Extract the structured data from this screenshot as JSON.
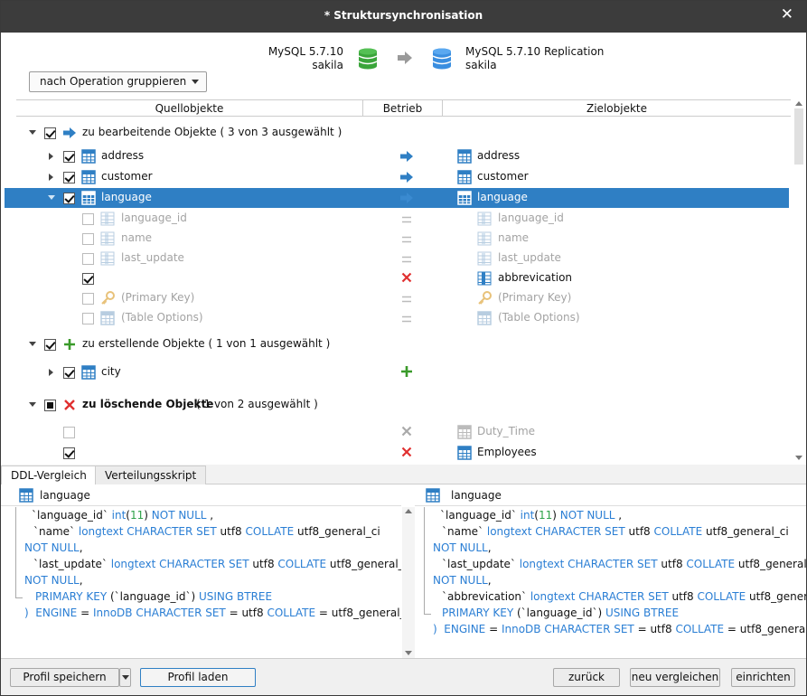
{
  "window": {
    "title": "* Struktursynchronisation",
    "close_glyph": "✕"
  },
  "connection": {
    "source": {
      "server": "MySQL 5.7.10",
      "schema": "sakila",
      "color": "#3aa53a"
    },
    "target": {
      "server": "MySQL 5.7.10 Replication",
      "schema": "sakila",
      "color": "#3a8ee0"
    }
  },
  "group_select": {
    "value": "nach Operation gruppieren"
  },
  "columns": {
    "source": "Quellobjekte",
    "operation": "Betrieb",
    "target": "Zielobjekte"
  },
  "tree": {
    "group_modify": {
      "label": "zu bearbeitende Objekte ( 3 von 3 ausgewählt )"
    },
    "address": {
      "src": "address",
      "dst": "address"
    },
    "customer": {
      "src": "customer",
      "dst": "customer"
    },
    "language": {
      "src": "language",
      "dst": "language"
    },
    "fields": [
      {
        "src": "language_id",
        "dst": "language_id"
      },
      {
        "src": "name",
        "dst": "name"
      },
      {
        "src": "last_update",
        "dst": "last_update"
      },
      {
        "src": "",
        "dst": "abbrevication"
      },
      {
        "src": "(Primary Key)",
        "dst": "(Primary Key)"
      },
      {
        "src": "(Table Options)",
        "dst": "(Table Options)"
      }
    ],
    "group_create": {
      "label": "zu erstellende Objekte ( 1 von 1 ausgewählt )"
    },
    "city": {
      "src": "city"
    },
    "group_delete": {
      "label": "zu löschende Objekte",
      "count": "( 1 von 2 ausgewählt )"
    },
    "duty": {
      "dst": "Duty_Time"
    },
    "employees": {
      "dst": "Employees"
    }
  },
  "tabs": {
    "ddl": "DDL-Vergleich",
    "script": "Verteilungsskript"
  },
  "ddl": {
    "left_title": "language",
    "right_title": "language"
  },
  "footer": {
    "save_profile": "Profil speichern",
    "load_profile": "Profil laden",
    "back": "zurück",
    "compare": "neu vergleichen",
    "setup": "einrichten"
  }
}
